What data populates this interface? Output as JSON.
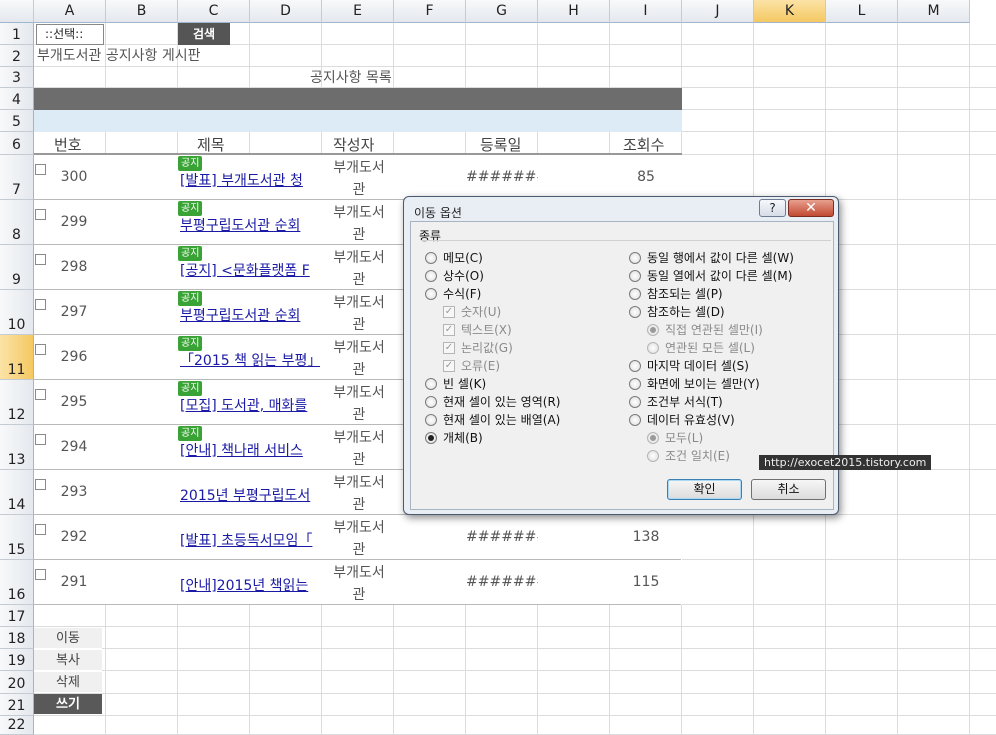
{
  "columns": [
    "A",
    "B",
    "C",
    "D",
    "E",
    "F",
    "G",
    "H",
    "I",
    "J",
    "K",
    "L",
    "M"
  ],
  "rows": [
    "1",
    "2",
    "3",
    "4",
    "5",
    "6",
    "7",
    "8",
    "9",
    "10",
    "11",
    "12",
    "13",
    "14",
    "15",
    "16",
    "17",
    "18",
    "19",
    "20",
    "21",
    "22"
  ],
  "toolbar": {
    "select_label": "::선택::",
    "search_label": "검색"
  },
  "board_title": "부개도서관 공지사항 게시판",
  "list_title": "공지사항 목록",
  "table_headers": {
    "no": "번호",
    "title": "제목",
    "author": "작성자",
    "date": "등록일",
    "views": "조회수"
  },
  "notice_badge": "공지",
  "posts": [
    {
      "no": "300",
      "title": "[발표] 부개도서관 청",
      "author_1": "부개도서",
      "author_2": "관",
      "date": "#######",
      "views": "85"
    },
    {
      "no": "299",
      "title": "부평구립도서관 순회",
      "author_1": "부개도서",
      "author_2": "관",
      "date": "",
      "views": ""
    },
    {
      "no": "298",
      "title": "[공지] <문화플랫폼 F",
      "author_1": "부개도서",
      "author_2": "관",
      "date": "",
      "views": ""
    },
    {
      "no": "297",
      "title": "부평구립도서관 순회",
      "author_1": "부개도서",
      "author_2": "관",
      "date": "",
      "views": ""
    },
    {
      "no": "296",
      "title": "「2015 책 읽는 부평」",
      "author_1": "부개도서",
      "author_2": "관",
      "date": "",
      "views": ""
    },
    {
      "no": "295",
      "title": "[모집] 도서관, 매화를",
      "author_1": "부개도서",
      "author_2": "관",
      "date": "",
      "views": ""
    },
    {
      "no": "294",
      "title": "[안내] 책나래 서비스",
      "author_1": "부개도서",
      "author_2": "관",
      "date": "",
      "views": ""
    },
    {
      "no": "293",
      "title": "2015년 부평구립도서",
      "author_1": "부개도서",
      "author_2": "관",
      "date": "",
      "views": ""
    },
    {
      "no": "292",
      "title": "[발표] 초등독서모임「",
      "author_1": "부개도서",
      "author_2": "관",
      "date": "#######",
      "views": "138"
    },
    {
      "no": "291",
      "title": "[안내]2015년 책읽는",
      "author_1": "부개도서",
      "author_2": "관",
      "date": "#######",
      "views": "115"
    }
  ],
  "side_buttons": [
    "이동",
    "복사",
    "삭제",
    "쓰기"
  ],
  "dialog": {
    "title": "이동 옵션",
    "help": "?",
    "close": "✕",
    "group": "종류",
    "left_options": [
      {
        "label": "메모(C)",
        "checked": false,
        "dim": false
      },
      {
        "label": "상수(O)",
        "checked": false,
        "dim": false
      },
      {
        "label": "수식(F)",
        "checked": false,
        "dim": false
      },
      {
        "label": "숫자(U)",
        "checked": true,
        "dim": true
      },
      {
        "label": "텍스트(X)",
        "checked": true,
        "dim": true
      },
      {
        "label": "논리값(G)",
        "checked": true,
        "dim": true
      },
      {
        "label": "오류(E)",
        "checked": true,
        "dim": true
      },
      {
        "label": "빈 셀(K)",
        "checked": false,
        "dim": false
      },
      {
        "label": "현재 셀이 있는 영역(R)",
        "checked": false,
        "dim": false
      },
      {
        "label": "현재 셀이 있는 배열(A)",
        "checked": false,
        "dim": false
      },
      {
        "label": "개체(B)",
        "checked": true,
        "dim": false
      }
    ],
    "right_options": [
      {
        "label": "동일 행에서 값이 다른 셀(W)",
        "checked": false,
        "dim": false
      },
      {
        "label": "동일 열에서 값이 다른 셀(M)",
        "checked": false,
        "dim": false
      },
      {
        "label": "참조되는 셀(P)",
        "checked": false,
        "dim": false
      },
      {
        "label": "참조하는 셀(D)",
        "checked": false,
        "dim": false
      },
      {
        "label": "직접 연관된 셀만(I)",
        "checked": true,
        "dim": true
      },
      {
        "label": "연관된 모든 셀(L)",
        "checked": false,
        "dim": true
      },
      {
        "label": "마지막 데이터 셀(S)",
        "checked": false,
        "dim": false
      },
      {
        "label": "화면에 보이는 셀만(Y)",
        "checked": false,
        "dim": false
      },
      {
        "label": "조건부 서식(T)",
        "checked": false,
        "dim": false
      },
      {
        "label": "데이터 유효성(V)",
        "checked": false,
        "dim": false
      },
      {
        "label": "모두(L)",
        "checked": true,
        "dim": true
      },
      {
        "label": "조건 일치(E)",
        "checked": false,
        "dim": true
      }
    ],
    "ok": "확인",
    "cancel": "취소"
  },
  "watermark": "http://exocet2015.tistory.com"
}
